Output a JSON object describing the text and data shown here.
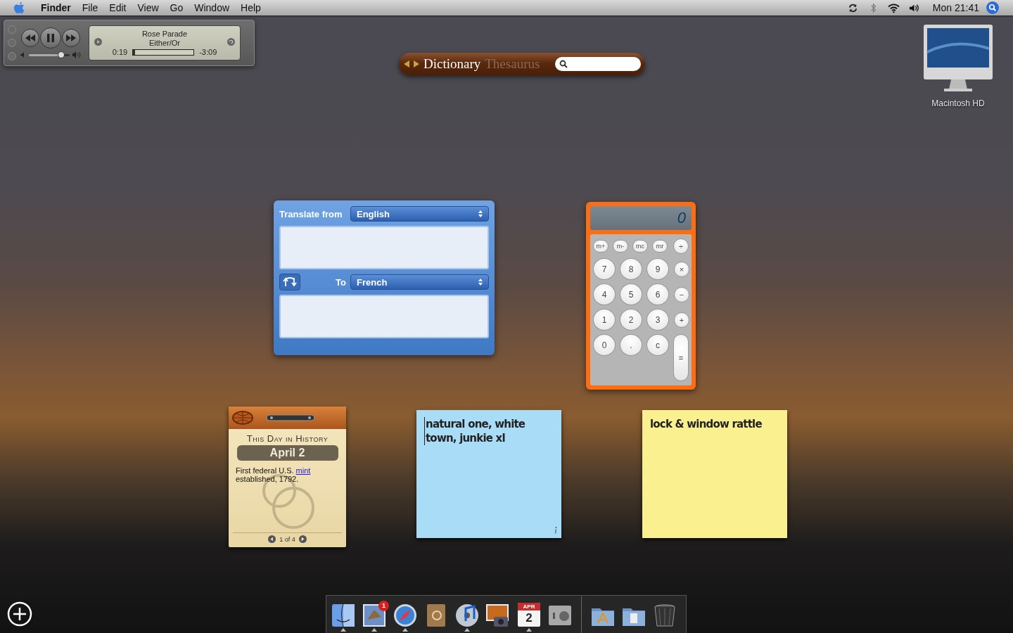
{
  "menubar": {
    "app": "Finder",
    "menus": [
      "File",
      "Edit",
      "View",
      "Go",
      "Window",
      "Help"
    ],
    "clock": "Mon 21:41"
  },
  "itunes": {
    "playing": true,
    "song": "Rose Parade",
    "album": "Either/Or",
    "elapsed": "0:19",
    "remaining": "-3:09",
    "progress": {
      "level": 0.03
    },
    "volume": {
      "level": 0.8
    }
  },
  "dictionary": {
    "tabs": [
      {
        "label": "Dictionary",
        "selected": true
      },
      {
        "label": "Thesaurus",
        "selected": false
      }
    ]
  },
  "disk": {
    "label": "Macintosh HD"
  },
  "translator": {
    "from_label": "Translate from",
    "from": "English",
    "to_label": "To",
    "to": "French"
  },
  "calculator": {
    "display": "0",
    "top_row": [
      {
        "label": "m+",
        "kind": "memory"
      },
      {
        "label": "m-",
        "kind": "memory"
      },
      {
        "label": "mc",
        "kind": "memory"
      },
      {
        "label": "mr",
        "kind": "memory"
      },
      {
        "label": "÷",
        "kind": "operator"
      }
    ],
    "keys": [
      {
        "label": "7",
        "kind": "digit"
      },
      {
        "label": "8",
        "kind": "digit"
      },
      {
        "label": "9",
        "kind": "digit"
      },
      {
        "label": "×",
        "kind": "operator"
      },
      {
        "label": "4",
        "kind": "digit"
      },
      {
        "label": "5",
        "kind": "digit"
      },
      {
        "label": "6",
        "kind": "digit"
      },
      {
        "label": "−",
        "kind": "operator"
      },
      {
        "label": "1",
        "kind": "digit"
      },
      {
        "label": "2",
        "kind": "digit"
      },
      {
        "label": "3",
        "kind": "digit"
      },
      {
        "label": "+",
        "kind": "operator"
      },
      {
        "label": "0",
        "kind": "digit"
      },
      {
        "label": ".",
        "kind": "digit"
      },
      {
        "label": "c",
        "kind": "digit"
      },
      {
        "label": "=",
        "kind": "equals"
      }
    ]
  },
  "history": {
    "heading": "This Day in History",
    "date": "April 2",
    "fact_start": "First federal U.S.",
    "link": "mint",
    "fact_end": "established, 1792.",
    "page": "1 of 4"
  },
  "stickies": [
    {
      "text": "natural one, white town, junkie xl",
      "color": "#a9dcf7",
      "cursor": true
    },
    {
      "text": "lock & window rattle",
      "color": "#fbf08f",
      "cursor": false
    }
  ],
  "dock": {
    "apps": [
      {
        "kind": "finder",
        "running": true
      },
      {
        "kind": "mail",
        "running": true,
        "badge": "1"
      },
      {
        "kind": "safari",
        "running": true
      },
      {
        "kind": "addressbook",
        "running": false
      },
      {
        "kind": "itunes",
        "running": true
      },
      {
        "kind": "iphoto",
        "running": false
      },
      {
        "kind": "ical",
        "running": true,
        "month": "APR",
        "day": "2"
      },
      {
        "kind": "prefs",
        "running": false
      }
    ],
    "stacks": [
      {
        "kind": "applications"
      },
      {
        "kind": "documents"
      },
      {
        "kind": "trash"
      }
    ]
  }
}
